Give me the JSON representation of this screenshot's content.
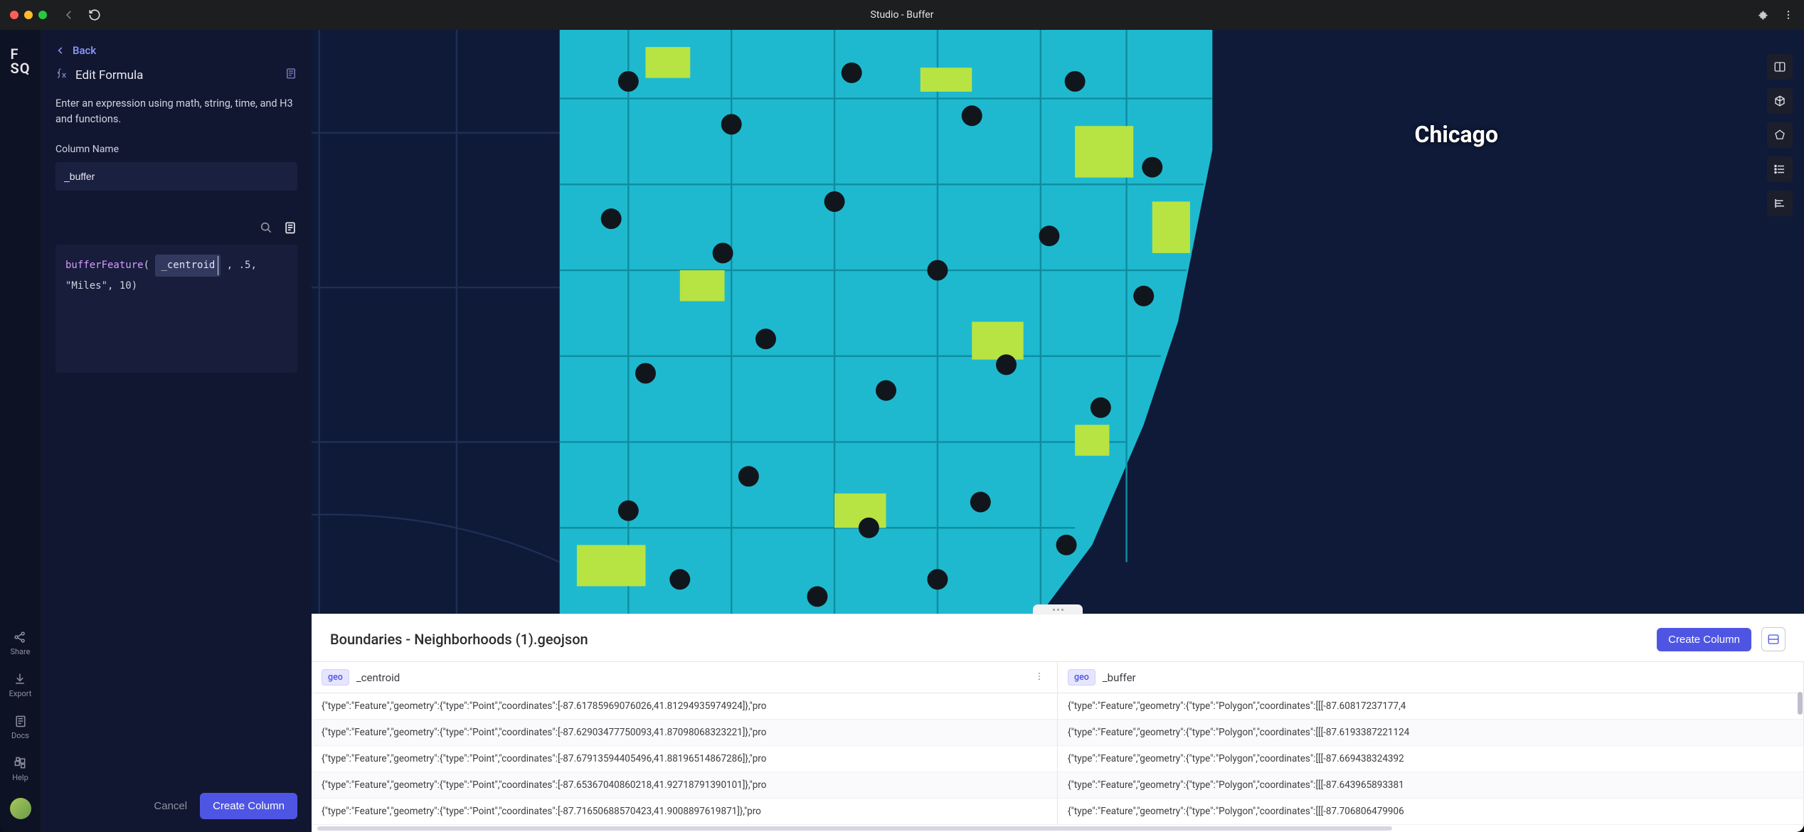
{
  "window": {
    "title": "Studio - Buffer"
  },
  "rail": {
    "logo_line1": "F",
    "logo_line2": "SQ",
    "items": [
      {
        "key": "share",
        "label": "Share"
      },
      {
        "key": "export",
        "label": "Export"
      },
      {
        "key": "docs",
        "label": "Docs"
      },
      {
        "key": "help",
        "label": "Help"
      }
    ]
  },
  "panel": {
    "back_label": "Back",
    "title": "Edit Formula",
    "description": "Enter an expression using math, string, time, and H3 and functions.",
    "column_name_label": "Column Name",
    "column_name_value": "_buffer",
    "code": {
      "fn": "bufferFeature",
      "open": "( ",
      "chip": "_centroid",
      "rest": " , .5, \"Miles\", 10)"
    },
    "cancel_label": "Cancel",
    "submit_label": "Create Column"
  },
  "map": {
    "city_label": "Chicago",
    "tools": [
      {
        "key": "split",
        "icon": "columns-icon"
      },
      {
        "key": "3d",
        "icon": "cube-icon"
      },
      {
        "key": "polygon",
        "icon": "polygon-icon"
      },
      {
        "key": "legend",
        "icon": "list-icon"
      },
      {
        "key": "align",
        "icon": "align-left-icon"
      }
    ]
  },
  "table": {
    "title": "Boundaries - Neighborhoods (1).geojson",
    "create_label": "Create Column",
    "columns": [
      {
        "type_chip": "geo",
        "name": "_centroid",
        "show_menu": true
      },
      {
        "type_chip": "geo",
        "name": "_buffer",
        "show_menu": false
      }
    ],
    "rows": [
      {
        "centroid": "{\"type\":\"Feature\",\"geometry\":{\"type\":\"Point\",\"coordinates\":[-87.61785969076026,41.81294935974924]},\"pro",
        "buffer": "{\"type\":\"Feature\",\"geometry\":{\"type\":\"Polygon\",\"coordinates\":[[[-87.60817237177,4"
      },
      {
        "centroid": "{\"type\":\"Feature\",\"geometry\":{\"type\":\"Point\",\"coordinates\":[-87.62903477750093,41.87098068323221]},\"pro",
        "buffer": "{\"type\":\"Feature\",\"geometry\":{\"type\":\"Polygon\",\"coordinates\":[[[-87.6193387221124"
      },
      {
        "centroid": "{\"type\":\"Feature\",\"geometry\":{\"type\":\"Point\",\"coordinates\":[-87.67913594405496,41.88196514867286]},\"pro",
        "buffer": "{\"type\":\"Feature\",\"geometry\":{\"type\":\"Polygon\",\"coordinates\":[[[-87.669438324392"
      },
      {
        "centroid": "{\"type\":\"Feature\",\"geometry\":{\"type\":\"Point\",\"coordinates\":[-87.65367040860218,41.92718791390101]},\"pro",
        "buffer": "{\"type\":\"Feature\",\"geometry\":{\"type\":\"Polygon\",\"coordinates\":[[[-87.643965893381"
      },
      {
        "centroid": "{\"type\":\"Feature\",\"geometry\":{\"type\":\"Point\",\"coordinates\":[-87.71650688570423,41.9008897619871]},\"pro",
        "buffer": "{\"type\":\"Feature\",\"geometry\":{\"type\":\"Polygon\",\"coordinates\":[[[-87.706806479906"
      }
    ]
  },
  "colors": {
    "accent": "#4f55e3",
    "panel_bg": "#121731",
    "map_water": "#0e1a38",
    "map_land": "#26c4d6",
    "map_park": "#b7e442"
  }
}
